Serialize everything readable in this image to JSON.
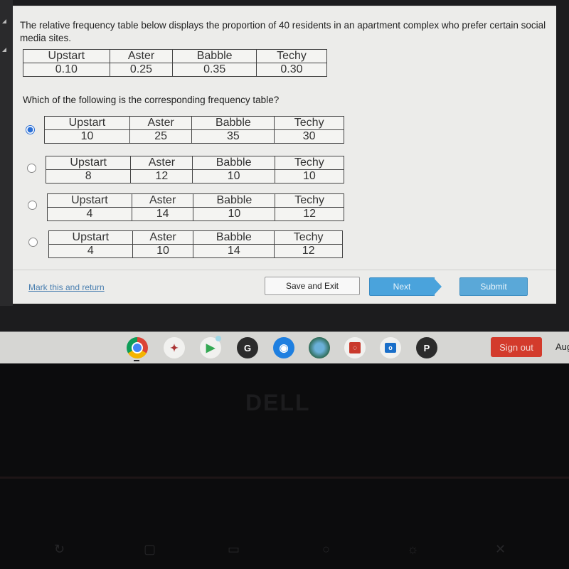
{
  "question": {
    "text": "The relative frequency table below displays the proportion of 40 residents in an apartment complex who prefer certain social media sites.",
    "table": {
      "headers": [
        "Upstart",
        "Aster",
        "Babble",
        "Techy"
      ],
      "values": [
        "0.10",
        "0.25",
        "0.35",
        "0.30"
      ]
    },
    "prompt": "Which of the following is the corresponding frequency table?"
  },
  "options": [
    {
      "selected": true,
      "headers": [
        "Upstart",
        "Aster",
        "Babble",
        "Techy"
      ],
      "values": [
        "10",
        "25",
        "35",
        "30"
      ]
    },
    {
      "selected": false,
      "headers": [
        "Upstart",
        "Aster",
        "Babble",
        "Techy"
      ],
      "values": [
        "8",
        "12",
        "10",
        "10"
      ]
    },
    {
      "selected": false,
      "headers": [
        "Upstart",
        "Aster",
        "Babble",
        "Techy"
      ],
      "values": [
        "4",
        "14",
        "10",
        "12"
      ]
    },
    {
      "selected": false,
      "headers": [
        "Upstart",
        "Aster",
        "Babble",
        "Techy"
      ],
      "values": [
        "4",
        "10",
        "14",
        "12"
      ]
    }
  ],
  "footer": {
    "mark_link": "Mark this and return",
    "save_exit": "Save and Exit",
    "next": "Next",
    "submit": "Submit"
  },
  "shelf": {
    "apps": [
      {
        "name": "chrome",
        "label": ""
      },
      {
        "name": "app-mascot",
        "label": ""
      },
      {
        "name": "play-store",
        "label": ""
      },
      {
        "name": "g-app",
        "label": "G"
      },
      {
        "name": "camera",
        "label": ""
      },
      {
        "name": "earth",
        "label": ""
      },
      {
        "name": "red-app",
        "label": ""
      },
      {
        "name": "outlook",
        "label": ""
      },
      {
        "name": "p-app",
        "label": "P"
      }
    ],
    "sign_out": "Sign out",
    "clock": "Aug"
  },
  "bezel": {
    "brand": "DELL"
  },
  "colors": {
    "accent": "#4aa3dc",
    "sign_out": "#d33b2c",
    "radio_selected": "#2a6fd6"
  }
}
